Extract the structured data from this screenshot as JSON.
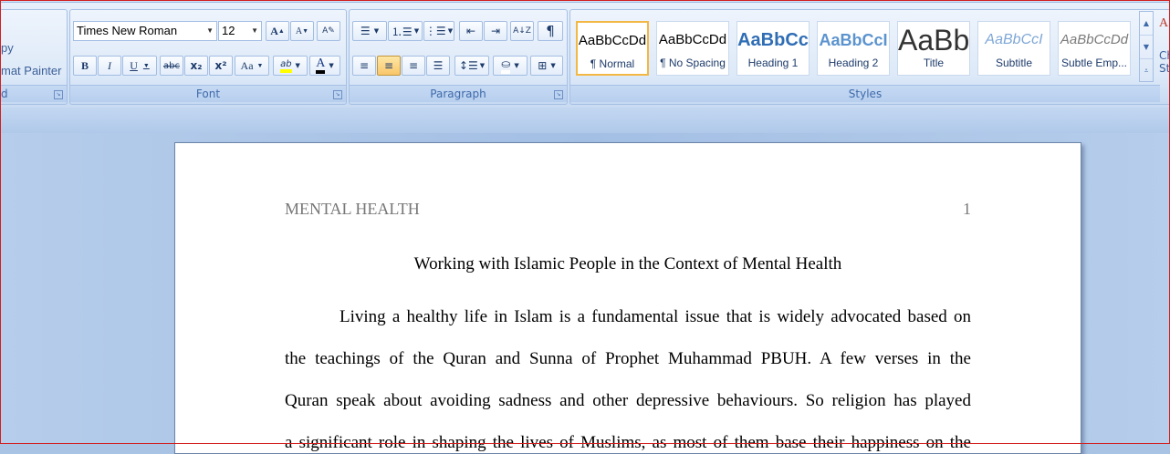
{
  "clipboard": {
    "copy_label": "py",
    "format_painter_label": "mat Painter",
    "group_label": "d"
  },
  "font": {
    "family": "Times New Roman",
    "size": "12",
    "grow_label": "A",
    "shrink_label": "A",
    "bold": "B",
    "italic": "I",
    "underline": "U",
    "strikethrough": "abc",
    "subscript": "x₂",
    "superscript": "x²",
    "change_case": "Aa",
    "highlight": "ab",
    "font_color": "A",
    "group_label": "Font"
  },
  "paragraph": {
    "group_label": "Paragraph",
    "pilcrow": "¶"
  },
  "styles": {
    "group_label": "Styles",
    "tiles": [
      {
        "sample": "AaBbCcDd",
        "name": "¶ Normal"
      },
      {
        "sample": "AaBbCcDd",
        "name": "¶ No Spacing"
      },
      {
        "sample": "AaBbCc",
        "name": "Heading 1"
      },
      {
        "sample": "AaBbCcI",
        "name": "Heading 2"
      },
      {
        "sample": "AaBb",
        "name": "Title"
      },
      {
        "sample": "AaBbCcI",
        "name": "Subtitle"
      },
      {
        "sample": "AaBbCcDd",
        "name": "Subtle Emp..."
      }
    ],
    "change_styles_label_1": "Ch",
    "change_styles_label_2": "St"
  },
  "document": {
    "running_head": "MENTAL HEALTH",
    "page_number": "1",
    "title": "Working with Islamic People in the Context of Mental Health",
    "lines": [
      "Living a healthy life in Islam is a fundamental issue that is widely advocated based on",
      "the teachings of the Quran and Sunna of Prophet Muhammad PBUH. A few verses in the",
      "Quran speak about avoiding sadness and other depressive behaviours. So religion has played",
      "a significant role in shaping the lives of Muslims, as most of them base their happiness on the"
    ]
  },
  "colors": {
    "selected_style_border": "#f3b743",
    "ribbon_text": "#15428b",
    "frame_border": "#d21f1f"
  }
}
